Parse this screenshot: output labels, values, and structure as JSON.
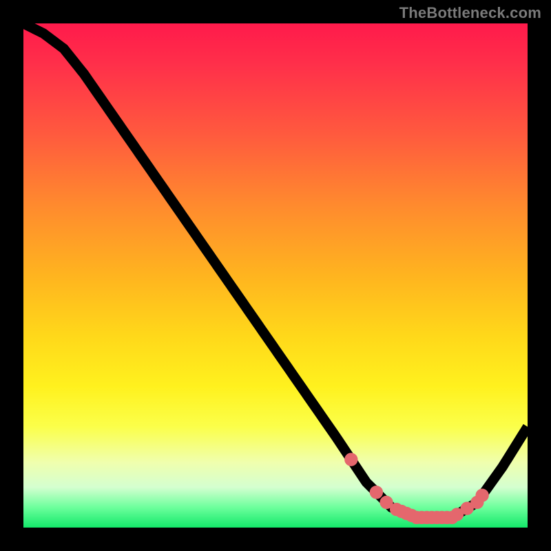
{
  "attribution": "TheBottleneck.com",
  "chart_data": {
    "type": "line",
    "title": "",
    "xlabel": "",
    "ylabel": "",
    "xlim": [
      0,
      100
    ],
    "ylim": [
      0,
      100
    ],
    "curve": [
      {
        "x": 0,
        "y": 100
      },
      {
        "x": 4,
        "y": 98
      },
      {
        "x": 8,
        "y": 95
      },
      {
        "x": 12,
        "y": 90
      },
      {
        "x": 62,
        "y": 18
      },
      {
        "x": 68,
        "y": 9
      },
      {
        "x": 73,
        "y": 4
      },
      {
        "x": 78,
        "y": 2
      },
      {
        "x": 85,
        "y": 2
      },
      {
        "x": 90,
        "y": 5
      },
      {
        "x": 95,
        "y": 12
      },
      {
        "x": 100,
        "y": 20
      }
    ],
    "markers_x": [
      65,
      70,
      72,
      74,
      75,
      76,
      77,
      78,
      79,
      80,
      81,
      82,
      83,
      84,
      85,
      86,
      88,
      90,
      91
    ],
    "marker_radius": 6,
    "gradient_stops": [
      {
        "pos": 0,
        "color": "#ff1a4b"
      },
      {
        "pos": 50,
        "color": "#ffd81a"
      },
      {
        "pos": 100,
        "color": "#13e86a"
      }
    ]
  }
}
